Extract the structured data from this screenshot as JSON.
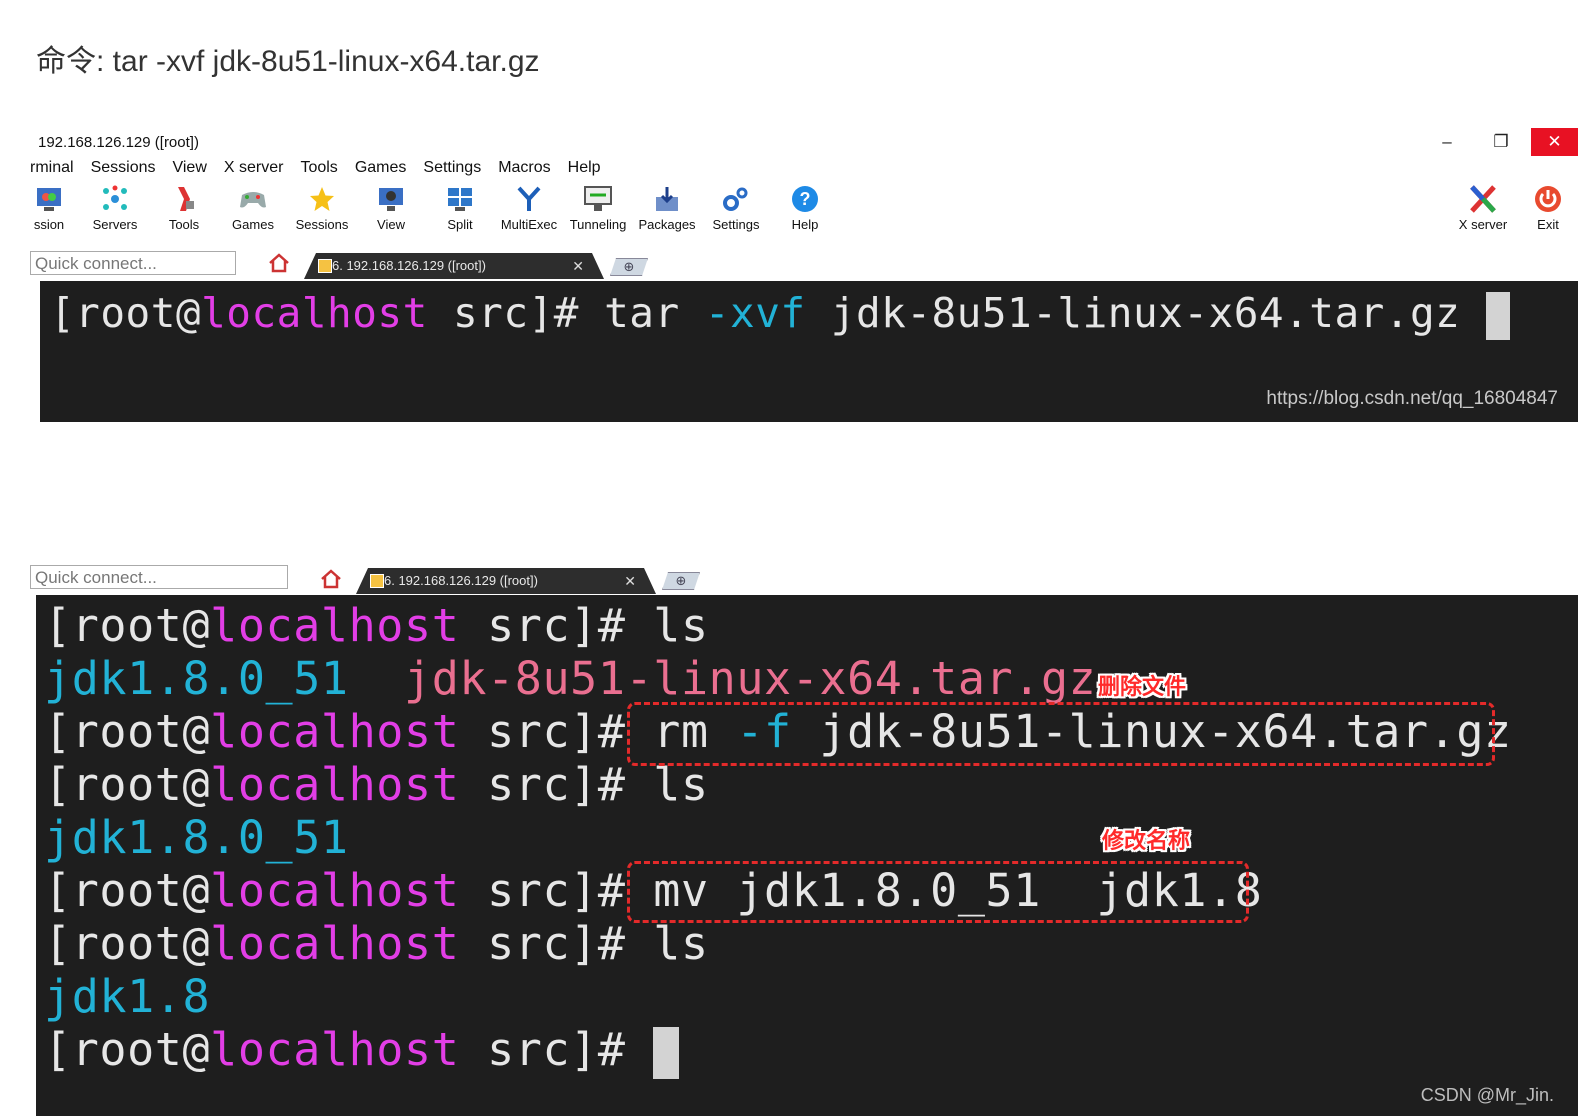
{
  "heading": "命令: tar -xvf jdk-8u51-linux-x64.tar.gz",
  "window": {
    "title": "192.168.126.129 ([root])",
    "controls": {
      "minimize": "–",
      "restore": "❐",
      "close": "✕"
    }
  },
  "menu": [
    "rminal",
    "Sessions",
    "View",
    "X server",
    "Tools",
    "Games",
    "Settings",
    "Macros",
    "Help"
  ],
  "toolbar": {
    "items": [
      "ssion",
      "Servers",
      "Tools",
      "Games",
      "Sessions",
      "View",
      "Split",
      "MultiExec",
      "Tunneling",
      "Packages",
      "Settings",
      "Help"
    ],
    "right_items": [
      "X server",
      "Exit"
    ],
    "icons": [
      "session-icon",
      "servers-icon",
      "tools-icon",
      "games-icon",
      "sessions-star-icon",
      "view-icon",
      "split-icon",
      "multiexec-icon",
      "tunneling-icon",
      "packages-icon",
      "settings-icon",
      "help-icon",
      "x-server-icon",
      "exit-icon"
    ]
  },
  "quick_connect_1": "Quick connect...",
  "quick_connect_2": "Quick connect...",
  "tab_label": "6. 192.168.126.129 ([root])",
  "tab_close": "✕",
  "new_tab": "⊕",
  "colors": {
    "terminal_bg": "#1e1e1e",
    "host": "#e23ee6",
    "dir": "#22b2d6",
    "archive": "#ea6f90",
    "annotation": "#e32a2a"
  },
  "terminal1": {
    "prompt_open": "[root@",
    "host": "localhost",
    "prompt_close": " src]# ",
    "cmd": "tar ",
    "flag": "-xvf",
    "arg": " jdk-8u51-linux-x64.tar.gz ",
    "watermark": "https://blog.csdn.net/qq_16804847"
  },
  "terminal2": {
    "prompt_open": "[root@",
    "host": "localhost",
    "prompt_close": " src]# ",
    "cmd_ls": "ls",
    "ls1_dir": "jdk1.8.0_51",
    "ls1_sep": "  ",
    "ls1_archive": "jdk-8u51-linux-x64.tar.gz",
    "rm_cmd": "rm ",
    "rm_flag": "-f",
    "rm_arg": " jdk-8u51-linux-x64.tar.gz",
    "ls2_dir": "jdk1.8.0_51",
    "mv_cmd": "mv jdk1.8.0_51  jdk1.8",
    "ls3_dir": "jdk1.8",
    "annotation_delete": "删除文件",
    "annotation_rename": "修改名称",
    "watermark": "CSDN @Mr_Jin."
  }
}
